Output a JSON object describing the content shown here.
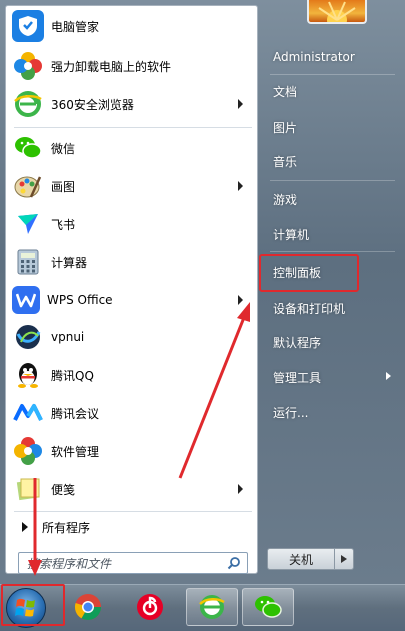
{
  "menu": {
    "items": [
      {
        "label": "电脑管家",
        "icon": "tencent-pc-manager-icon",
        "arrow": false
      },
      {
        "label": "强力卸载电脑上的软件",
        "icon": "uninstall-clover-icon",
        "arrow": false
      },
      {
        "label": "360安全浏览器",
        "icon": "360-browser-icon",
        "arrow": true
      },
      {
        "label": "微信",
        "icon": "wechat-icon",
        "arrow": false
      },
      {
        "label": "画图",
        "icon": "paint-icon",
        "arrow": true
      },
      {
        "label": "飞书",
        "icon": "feishu-icon",
        "arrow": false
      },
      {
        "label": "计算器",
        "icon": "calculator-icon",
        "arrow": false
      },
      {
        "label": "WPS Office",
        "icon": "wps-office-icon",
        "arrow": true
      },
      {
        "label": "vpnui",
        "icon": "vpn-icon",
        "arrow": false
      },
      {
        "label": "腾讯QQ",
        "icon": "qq-icon",
        "arrow": false
      },
      {
        "label": "腾讯会议",
        "icon": "tencent-meeting-icon",
        "arrow": false
      },
      {
        "label": "软件管理",
        "icon": "software-manager-icon",
        "arrow": false
      },
      {
        "label": "便笺",
        "icon": "sticky-notes-icon",
        "arrow": true
      }
    ],
    "all_programs": "所有程序",
    "search_placeholder": "搜索程序和文件"
  },
  "right": {
    "items": [
      {
        "label": "Administrator",
        "arrow": false
      },
      {
        "label": "文档",
        "arrow": false
      },
      {
        "label": "图片",
        "arrow": false
      },
      {
        "label": "音乐",
        "arrow": false
      },
      {
        "label": "游戏",
        "arrow": false
      },
      {
        "label": "计算机",
        "arrow": false
      },
      {
        "label": "控制面板",
        "arrow": false
      },
      {
        "label": "设备和打印机",
        "arrow": false
      },
      {
        "label": "默认程序",
        "arrow": false
      },
      {
        "label": "管理工具",
        "arrow": true
      },
      {
        "label": "运行...",
        "arrow": false
      }
    ],
    "shutdown_label": "关机"
  },
  "taskbar": {
    "apps": [
      "start-orb",
      "chrome-icon",
      "netease-music-icon",
      "360-browser-icon",
      "wechat-icon"
    ]
  },
  "colors": {
    "annotation": "#e0292d",
    "wechat": "#2dc100",
    "qq_blue": "#1a8dff"
  }
}
